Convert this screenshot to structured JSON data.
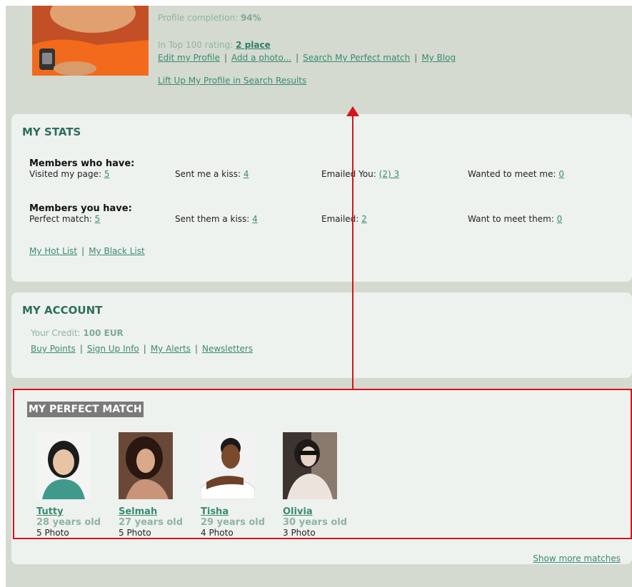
{
  "profile": {
    "completion_label": "Profile completion:",
    "completion_value": "94%",
    "rating_label": "In Top 100 rating:",
    "rating_value": "2 place",
    "links": [
      "Edit my Profile",
      "Add a photo...",
      "Search My Perfect match",
      "My Blog"
    ],
    "lift_up": "Lift Up My Profile in Search Results"
  },
  "stats": {
    "title": "MY STATS",
    "members_who_have": "Members who have:",
    "row1": [
      {
        "label": "Visited my page:",
        "value": "5"
      },
      {
        "label": "Sent me a kiss:",
        "value": "4"
      },
      {
        "label": "Emailed You:",
        "value": "(2) 3"
      },
      {
        "label": "Wanted to meet me:",
        "value": "0"
      }
    ],
    "members_you_have": "Members you have:",
    "row2": [
      {
        "label": "Perfect match:",
        "value": "5"
      },
      {
        "label": "Sent them a kiss:",
        "value": "4"
      },
      {
        "label": "Emailed:",
        "value": "2"
      },
      {
        "label": "Want to meet them:",
        "value": "0"
      }
    ],
    "hot_list": "My Hot List",
    "black_list": "My Black List"
  },
  "account": {
    "title": "MY ACCOUNT",
    "credit_label": "Your Credit:",
    "credit_value": "100 EUR",
    "links": [
      "Buy Points",
      "Sign Up Info",
      "My Alerts",
      "Newsletters"
    ]
  },
  "perfect_match": {
    "title": "MY PERFECT MATCH",
    "matches": [
      {
        "name": "Tutty",
        "age": "28 years old",
        "photos": "5 Photo"
      },
      {
        "name": "Selmah",
        "age": "27 years old",
        "photos": "5 Photo"
      },
      {
        "name": "Tisha",
        "age": "29 years old",
        "photos": "4 Photo"
      },
      {
        "name": "Olivia",
        "age": "30 years old",
        "photos": "3 Photo"
      }
    ],
    "show_more": "Show more matches"
  },
  "colors": {
    "accent": "#2d6e5c",
    "link": "#3a8a72",
    "annotation": "#d8121b"
  }
}
